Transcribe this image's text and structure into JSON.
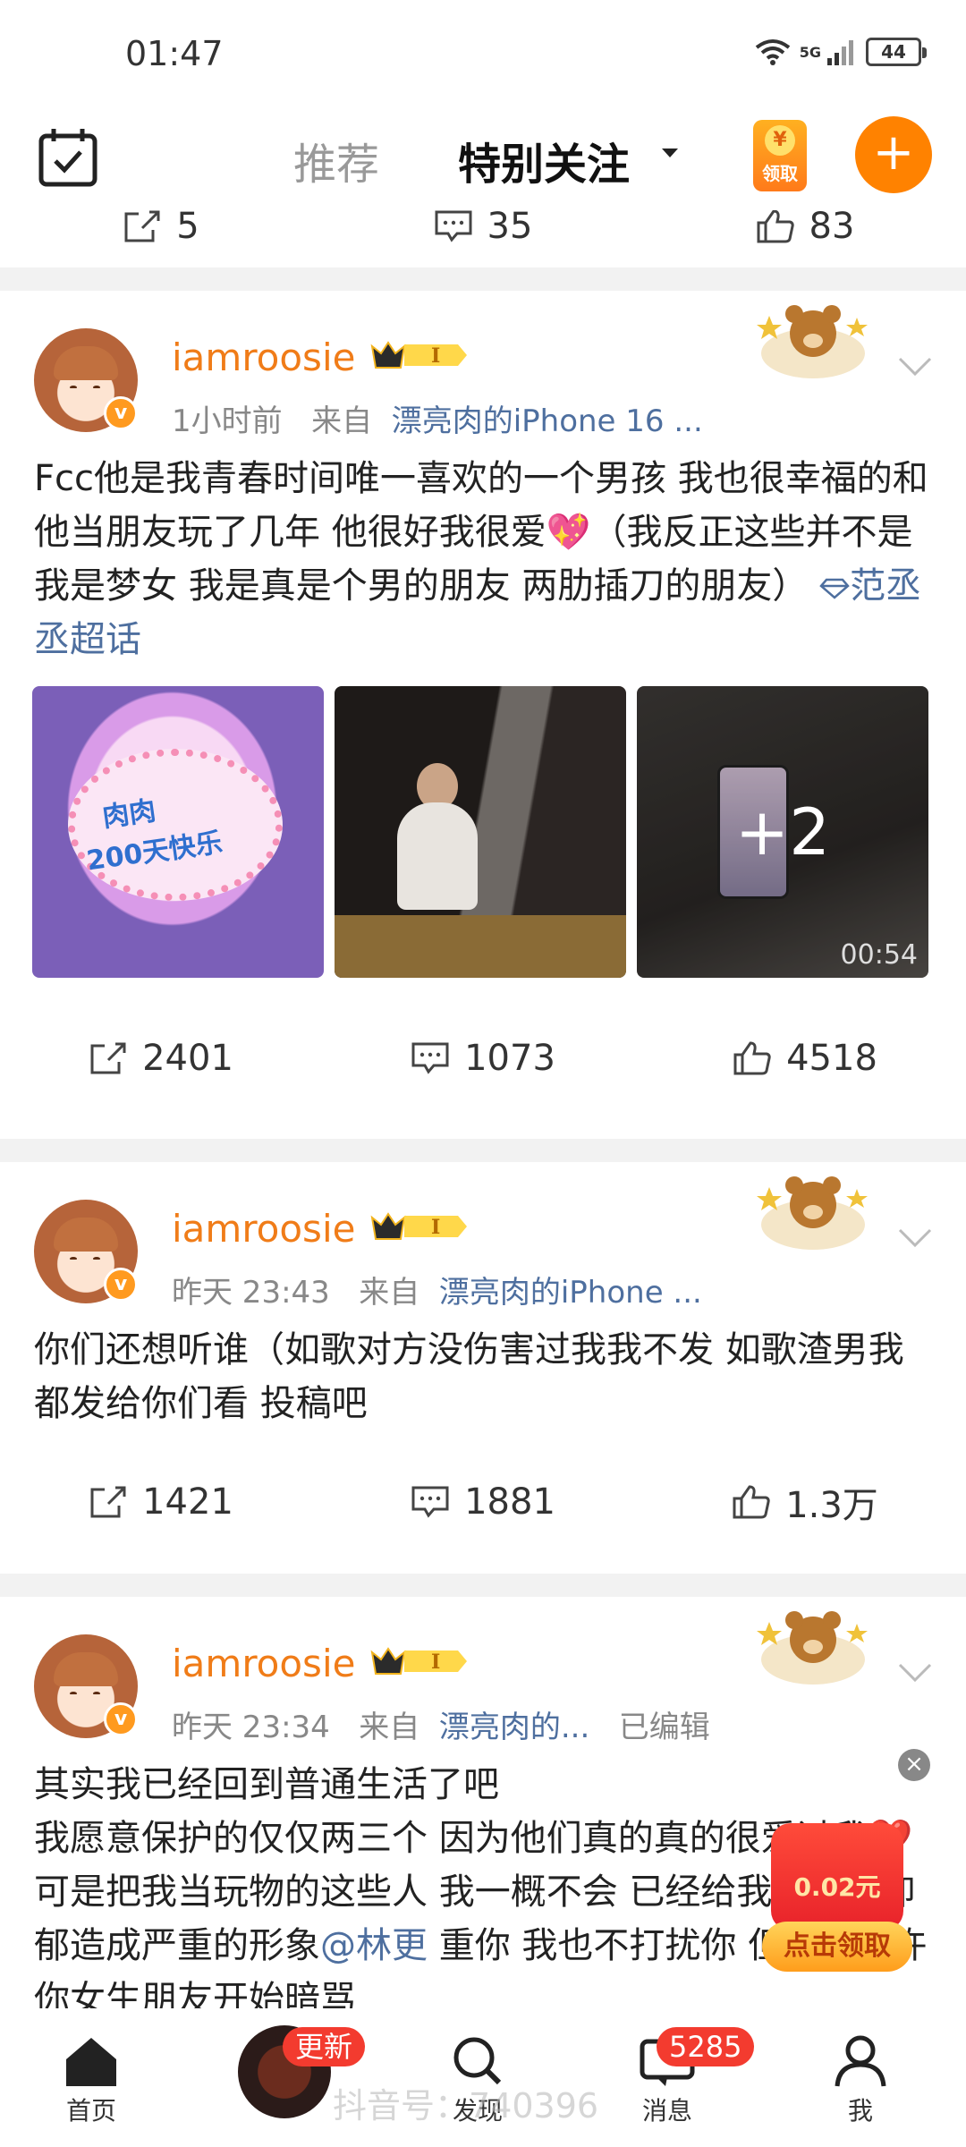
{
  "status_bar": {
    "time": "01:47",
    "network": "5G",
    "battery": "44"
  },
  "top_nav": {
    "tab_recommend": "推荐",
    "tab_special": "特别关注",
    "redpack_label": "领取",
    "redpack_symbol": "¥",
    "compose_symbol": "+"
  },
  "previous_post_actions": {
    "shares": "5",
    "comments": "35",
    "likes": "83"
  },
  "posts": [
    {
      "username": "iamroosie",
      "time": "1小时前",
      "from_label": "来自",
      "source": "漂亮肉的iPhone 16 ...",
      "text": "Fcc他是我青春时间唯一喜欢的一个男孩 我也很幸福的和他当朋友玩了几年  他很好我很爱💖（我反正这些并不是我是梦女 我是真是个男的朋友 两肋插刀的朋友）",
      "topic": "范丞丞超话",
      "topic_icon": "diamond-icon",
      "cake_text_1": "肉肉",
      "cake_text_2": "200天快乐",
      "media_more": "+2",
      "video_duration": "00:54",
      "shares": "2401",
      "comments": "1073",
      "likes": "4518"
    },
    {
      "username": "iamroosie",
      "time": "昨天 23:43",
      "from_label": "来自",
      "source": "漂亮肉的iPhone ...",
      "text": "你们还想听谁（如歌对方没伤害过我我不发 如歌渣男我都发给你们看 投稿吧",
      "shares": "1421",
      "comments": "1881",
      "likes": "1.3万"
    },
    {
      "username": "iamroosie",
      "time": "昨天 23:34",
      "from_label": "来自",
      "source": "漂亮肉的...",
      "edited": "已编辑",
      "text_line1": "其实我已经回到普通生活了吧",
      "text_line2": "我愿意保护的仅仅两三个 因为他们真的真的很爱过我❤️可是把我当玩物的这些人 我一概不会 已经给我的身心抑郁造成严重的形象",
      "mention": "@林更",
      "text_line3": " 重你 我也不打扰你 但我不允许你女生朋友开始暗骂"
    }
  ],
  "vip_badge_text": "I",
  "verified_mark": "v",
  "ad": {
    "close_symbol": "×",
    "amount": "0.02元",
    "cta": "点击领取"
  },
  "tab_bar": {
    "home": "首页",
    "discover": "发现",
    "messages": "消息",
    "me": "我",
    "update_badge": "更新",
    "message_count": "5285"
  },
  "watermark": "抖音号：",
  "watermark_digits": "740396"
}
